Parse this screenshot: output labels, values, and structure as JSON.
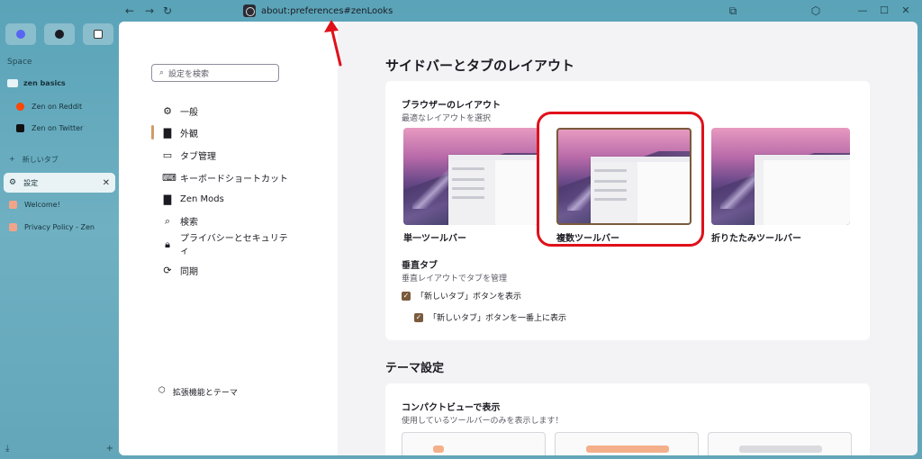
{
  "url": "about:preferences#zenLooks",
  "sidebar": {
    "space_label": "Space",
    "folder": "zen basics",
    "folder_items": [
      "Zen on Reddit",
      "Zen on Twitter"
    ],
    "new_tab": "新しいタブ",
    "tabs": [
      {
        "label": "設定",
        "active": true
      },
      {
        "label": "Welcome!",
        "active": false
      },
      {
        "label": "Privacy Policy - Zen",
        "active": false
      }
    ]
  },
  "nav": {
    "search_placeholder": "設定を検索",
    "items": [
      {
        "label": "一般",
        "icon": "gear-icon"
      },
      {
        "label": "外観",
        "icon": "brush-icon"
      },
      {
        "label": "タブ管理",
        "icon": "tab-icon"
      },
      {
        "label": "キーボードショートカット",
        "icon": "keyboard-icon"
      },
      {
        "label": "Zen Mods",
        "icon": "brush-icon"
      },
      {
        "label": "検索",
        "icon": "search-icon"
      },
      {
        "label": "プライバシーとセキュリティ",
        "icon": "lock-icon"
      },
      {
        "label": "同期",
        "icon": "sync-icon"
      }
    ],
    "extensions": "拡張機能とテーマ"
  },
  "main": {
    "title": "サイドバーとタブのレイアウト",
    "browser_layout_title": "ブラウザーのレイアウト",
    "browser_layout_sub": "最適なレイアウトを選択",
    "layouts": [
      "単一ツールバー",
      "複数ツールバー",
      "折りたたみツールバー"
    ],
    "selected_layout": "複数ツールバー",
    "vertical_tabs_title": "垂直タブ",
    "vertical_tabs_sub": "垂直レイアウトでタブを管理",
    "check1": "「新しいタブ」ボタンを表示",
    "check2": "「新しいタブ」ボタンを一番上に表示",
    "theme_title": "テーマ設定",
    "compact_title": "コンパクトビューで表示",
    "compact_sub": "使用しているツールバーのみを表示します！"
  },
  "colors": {
    "accent": "#7a5a3c",
    "highlight": "#e0101a"
  }
}
